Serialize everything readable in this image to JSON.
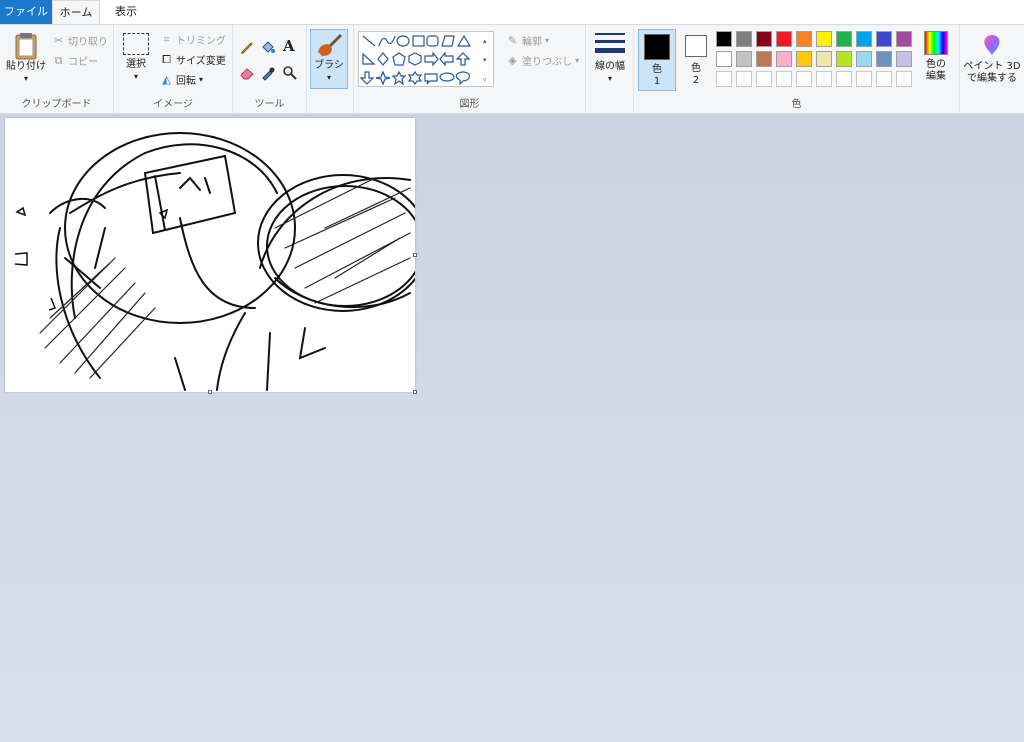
{
  "tabs": {
    "file": "ファイル",
    "home": "ホーム",
    "view": "表示"
  },
  "clipboard": {
    "paste": "貼り付け",
    "cut": "切り取り",
    "copy": "コピー",
    "label": "クリップボード"
  },
  "image": {
    "select": "選択",
    "crop": "トリミング",
    "resize": "サイズ変更",
    "rotate": "回転",
    "label": "イメージ"
  },
  "tools": {
    "label": "ツール"
  },
  "brush": {
    "label": "ブラシ"
  },
  "shapes": {
    "outline": "輪郭",
    "fill": "塗りつぶし",
    "label": "図形"
  },
  "size": {
    "label": "線の幅"
  },
  "colors": {
    "color1_label": "色",
    "color1_num": "1",
    "color2_label": "色",
    "color2_num": "2",
    "edit_line1": "色の",
    "edit_line2": "編集",
    "group_label": "色",
    "color1": "#000000",
    "color2": "#ffffff",
    "row1": [
      "#000000",
      "#7f7f7f",
      "#880015",
      "#ed1c24",
      "#ff7f27",
      "#fff200",
      "#22b14c",
      "#00a2e8",
      "#3f48cc",
      "#a349a4"
    ],
    "row2": [
      "#ffffff",
      "#c3c3c3",
      "#b97a57",
      "#ffaec9",
      "#ffc90e",
      "#efe4b0",
      "#b5e61d",
      "#99d9ea",
      "#7092be",
      "#c8bfe7"
    ],
    "row3": [
      "#ffffff",
      "#ffffff",
      "#ffffff",
      "#ffffff",
      "#ffffff",
      "#ffffff",
      "#ffffff",
      "#ffffff",
      "#ffffff",
      "#ffffff"
    ]
  },
  "paint3d": {
    "line1": "ペイント 3D",
    "line2": "で編集する"
  }
}
